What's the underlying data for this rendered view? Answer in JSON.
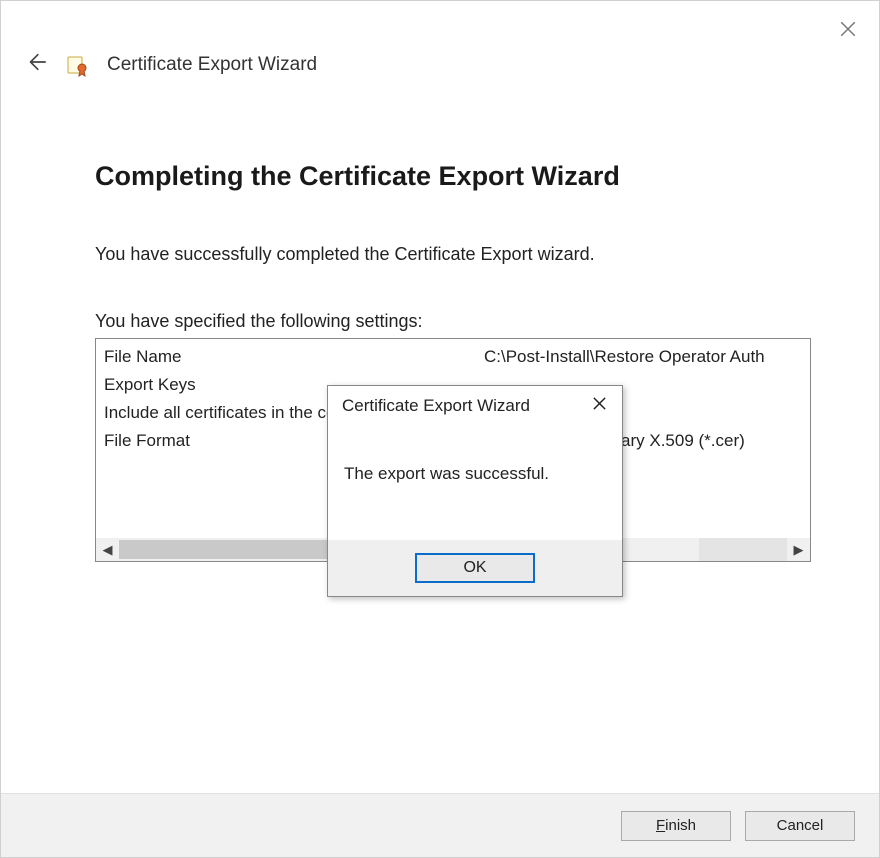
{
  "window": {
    "title": "Certificate Export Wizard"
  },
  "content": {
    "heading": "Completing the Certificate Export Wizard",
    "completion_text": "You have successfully completed the Certificate Export wizard.",
    "settings_label": "You have specified the following settings:",
    "settings_rows": [
      {
        "key": "File Name",
        "value": "C:\\Post-Install\\Restore Operator Auth"
      },
      {
        "key": "Export Keys",
        "value": ""
      },
      {
        "key": "Include all certificates in the certification path",
        "value": ""
      },
      {
        "key": "File Format",
        "value": "DER Encoded Binary X.509 (*.cer)"
      }
    ]
  },
  "footer": {
    "finish_label": "Finish",
    "finish_hotkey_char": "F",
    "cancel_label": "Cancel"
  },
  "modal": {
    "title": "Certificate Export Wizard",
    "message": "The export was successful.",
    "ok_label": "OK"
  }
}
